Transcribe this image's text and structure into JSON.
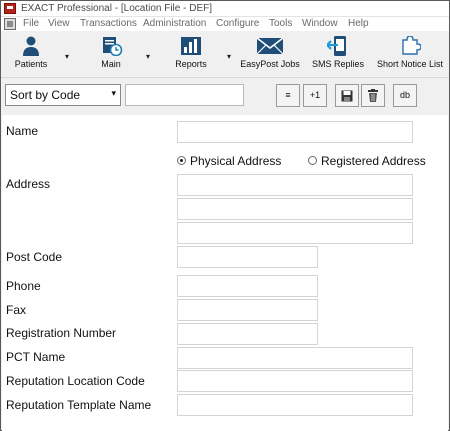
{
  "window": {
    "title": "EXACT Professional - [Location File - DEF]",
    "app_icon": "exact-app-icon"
  },
  "menubar": {
    "items": [
      "File",
      "View",
      "Transactions",
      "Administration",
      "Configure",
      "Tools",
      "Window",
      "Help"
    ]
  },
  "toolbar": {
    "buttons": [
      {
        "label": "Patients",
        "icon": "person-icon",
        "has_dropdown": true
      },
      {
        "label": "Main",
        "icon": "clock-document-icon",
        "has_dropdown": true
      },
      {
        "label": "Reports",
        "icon": "bar-chart-icon",
        "has_dropdown": true
      },
      {
        "label": "EasyPost Jobs",
        "icon": "envelope-icon",
        "has_dropdown": false
      },
      {
        "label": "SMS Replies",
        "icon": "phone-reply-icon",
        "has_dropdown": false
      },
      {
        "label": "Short Notice List",
        "icon": "puzzle-icon",
        "has_dropdown": false
      }
    ],
    "dropdown_glyph": "▾"
  },
  "sortbar": {
    "sort_value": "Sort by Code",
    "dropdown_glyph": "▾",
    "search_value": "",
    "buttons": [
      {
        "name": "list-button",
        "text": "≡"
      },
      {
        "name": "plus-one-button",
        "text": "+1"
      },
      {
        "name": "save-button",
        "text": ""
      },
      {
        "name": "delete-button",
        "text": ""
      },
      {
        "name": "db-button",
        "text": "db"
      }
    ]
  },
  "form": {
    "labels": {
      "name": "Name",
      "address": "Address",
      "post_code": "Post Code",
      "phone": "Phone",
      "fax": "Fax",
      "registration_number": "Registration Number",
      "pct_name": "PCT Name",
      "reputation_location_code": "Reputation Location Code",
      "reputation_template_name": "Reputation Template Name"
    },
    "address_type": {
      "options": [
        "Physical Address",
        "Registered Address"
      ],
      "selected": "Physical Address"
    },
    "values": {
      "name": "",
      "address_line_1": "",
      "address_line_2": "",
      "address_line_3": "",
      "post_code": "",
      "phone": "",
      "fax": "",
      "registration_number": "",
      "pct_name": "",
      "reputation_location_code": "",
      "reputation_template_name": ""
    }
  }
}
